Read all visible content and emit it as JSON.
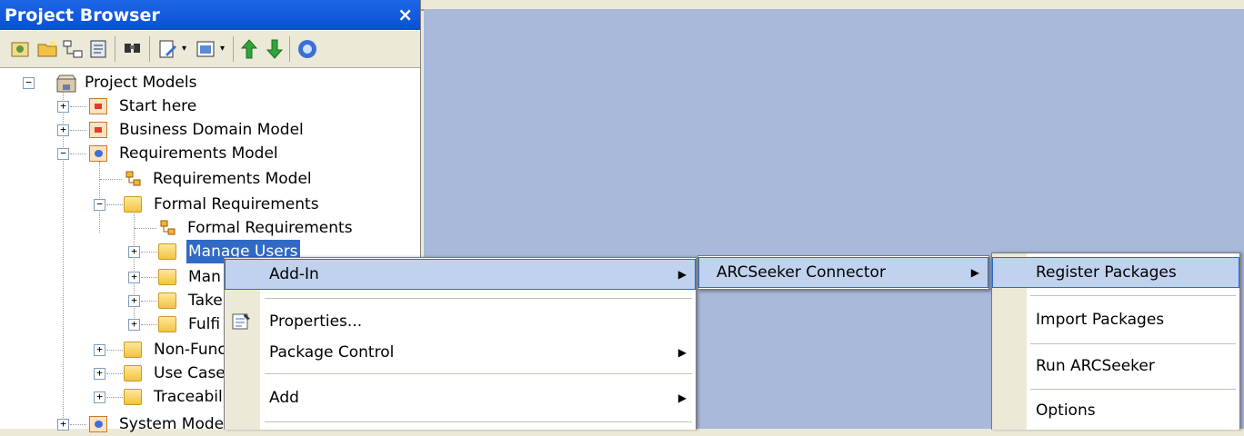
{
  "panel": {
    "title": "Project Browser",
    "close_glyph": "×"
  },
  "toolbar": {
    "icons": [
      "new-package-icon",
      "new-folder-icon",
      "new-diagram-icon",
      "new-element-icon",
      "find-icon",
      "edit-icon",
      "view-icon",
      "move-up-icon",
      "move-down-icon",
      "help-icon"
    ],
    "dropdown_glyph": "▾",
    "up_glyph": "🡑",
    "down_glyph": "🡓"
  },
  "tree": {
    "root": "Project Models",
    "items": [
      {
        "label": "Start here",
        "icon": "package-red-icon"
      },
      {
        "label": "Business Domain Model",
        "icon": "package-red-icon"
      },
      {
        "label": "Requirements Model",
        "icon": "package-blue-icon"
      },
      {
        "label": "Requirements Model",
        "icon": "diagram-icon"
      },
      {
        "label": "Formal Requirements",
        "icon": "folder-icon"
      },
      {
        "label": "Formal Requirements",
        "icon": "diagram-icon"
      },
      {
        "label": "Manage Users",
        "icon": "folder-icon",
        "selected": true
      },
      {
        "label": "Man",
        "icon": "folder-icon"
      },
      {
        "label": "Take",
        "icon": "folder-icon"
      },
      {
        "label": "Fulfi",
        "icon": "folder-icon"
      },
      {
        "label": "Non-Func",
        "icon": "folder-icon"
      },
      {
        "label": "Use Case",
        "icon": "folder-icon"
      },
      {
        "label": "Traceabil",
        "icon": "folder-icon"
      },
      {
        "label": "System Model",
        "icon": "package-blue-icon"
      }
    ],
    "expand_plus": "+",
    "expand_minus": "−"
  },
  "context_menu": {
    "items": [
      "Add-In",
      "Properties...",
      "Package Control",
      "Add"
    ],
    "arrow": "▶"
  },
  "submenu_addin": {
    "items": [
      "ARCSeeker Connector"
    ]
  },
  "submenu_arcseeker": {
    "items": [
      "Register Packages",
      "Import Packages",
      "Run ARCSeeker",
      "Options"
    ]
  },
  "colors": {
    "title_bar": "#0a4fd4",
    "canvas": "#a8b9da",
    "highlight": "#c1d2ee",
    "selection": "#316ac5"
  }
}
